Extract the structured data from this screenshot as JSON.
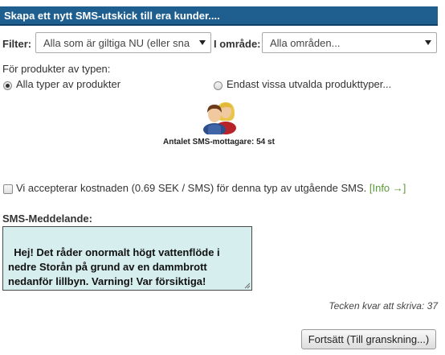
{
  "header": {
    "title": "Skapa ett nytt SMS-utskick till era kunder...."
  },
  "filters": {
    "filter_label": "Filter:",
    "filter_value": "Alla som är giltiga NU (eller sna",
    "area_label": "I område:",
    "area_value": "Alla områden..."
  },
  "products": {
    "heading": "För produkter av typen:",
    "options": [
      {
        "label": "Alla typer av produkter",
        "selected": true
      },
      {
        "label": "Endast vissa utvalda produkttyper...",
        "selected": false
      }
    ]
  },
  "recipients": {
    "icon": "people-icon",
    "text": "Antalet SMS-mottagare: 54 st"
  },
  "accept": {
    "checked": false,
    "text": "Vi accepterar kostnaden (0.69 SEK / SMS) för denna typ av utgående SMS.",
    "info_link": "[Info →]"
  },
  "message": {
    "label": "SMS-Meddelande:",
    "text": "Hej! Det råder onormalt högt vattenflöde i nedre Storån på grund av en dammbrott nedanför lillbyn. Varning! Var försiktiga!",
    "counter": "Tecken kvar att skriva: 37"
  },
  "actions": {
    "continue_label": "Fortsätt (Till granskning...)"
  },
  "colors": {
    "header_bg": "#1f5f8f",
    "textarea_bg": "#d6eeee",
    "link_green": "#5a9a3a"
  }
}
